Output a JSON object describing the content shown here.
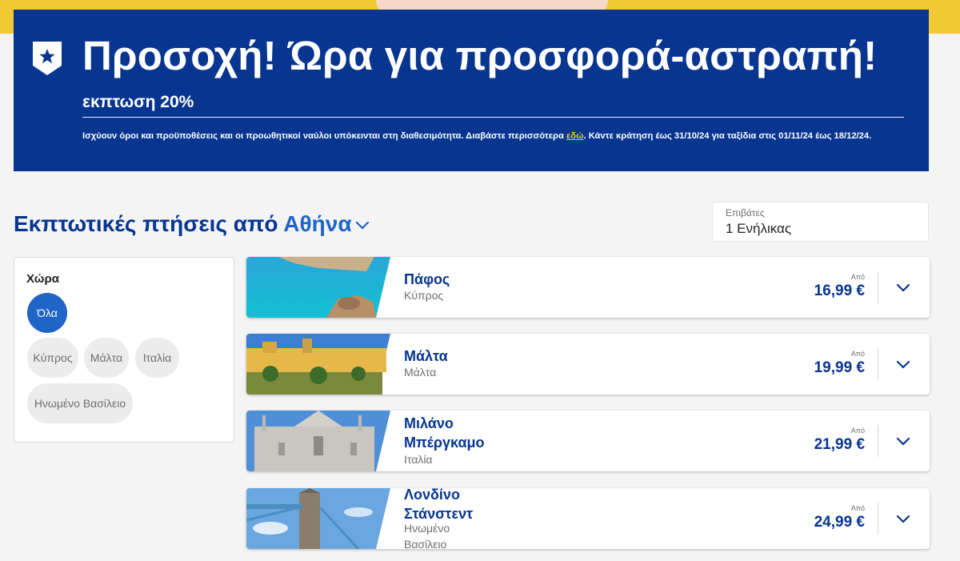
{
  "banner": {
    "title": "Προσοχή! Ώρα για προσφορά-αστραπή!",
    "subtitle": "εκπτωση 20%",
    "terms_before": "Ισχύουν όροι και προϋποθέσεις και οι προωθητικοί ναύλοι υπόκεινται στη διαθεσιμότητα. Διαβάστε περισσότερα ",
    "terms_link": "εδώ",
    "terms_after": ". Κάντε κράτηση έως 31/10/24 για ταξίδια στις 01/11/24 έως 18/12/24."
  },
  "heading": {
    "prefix": "Εκπτωτικές πτήσεις από ",
    "city": "Αθήνα"
  },
  "passengers": {
    "label": "Επιβάτες",
    "value": "1 Ενήλικας"
  },
  "filter": {
    "title": "Χώρα",
    "chips": [
      "Όλα",
      "Κύπρος",
      "Μάλτα",
      "Ιταλία",
      "Ηνωμένο Βασίλειο"
    ],
    "selected": "Όλα"
  },
  "price_prefix": "Από",
  "destinations": [
    {
      "name": "Πάφος",
      "country": "Κύπρος",
      "price": "16,99 €"
    },
    {
      "name": "Μάλτα",
      "country": "Μάλτα",
      "price": "19,99 €"
    },
    {
      "name": "Μιλάνο\nΜπέργκαμο",
      "country": "Ιταλία",
      "price": "21,99 €"
    },
    {
      "name": "Λονδίνο\nΣτάνστεντ",
      "country": "Ηνωμένο\nΒασίλειο",
      "price": "24,99 €"
    }
  ],
  "colors": {
    "brand_blue": "#073590",
    "accent_blue": "#1f64c7",
    "brand_yellow": "#f1c933"
  }
}
